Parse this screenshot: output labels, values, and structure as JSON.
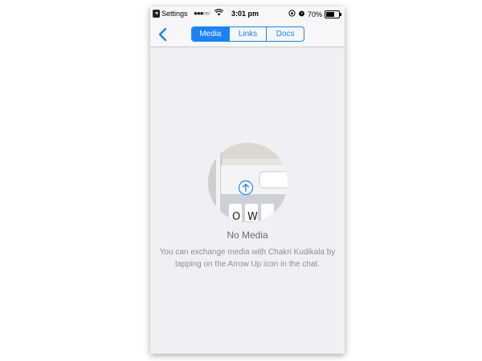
{
  "status_bar": {
    "app_name": "Settings",
    "signal": "●●●○○",
    "time": "3:01 pm",
    "battery_percent": "70%",
    "battery_level": 0.7
  },
  "nav": {
    "tabs": [
      {
        "label": "Media",
        "active": true
      },
      {
        "label": "Links",
        "active": false
      },
      {
        "label": "Docs",
        "active": false
      }
    ]
  },
  "empty_state": {
    "title": "No Media",
    "description": "You can exchange media with Chakri Kudikala by tapping on the Arrow Up icon in the chat."
  },
  "colors": {
    "accent": "#1a82fb",
    "background": "#efeff4",
    "bar": "#f7f7f9"
  },
  "icons": [
    "back-chevron-icon",
    "arrow-up-icon",
    "wifi-icon",
    "battery-icon",
    "alarm-icon",
    "lock-rotation-icon"
  ]
}
